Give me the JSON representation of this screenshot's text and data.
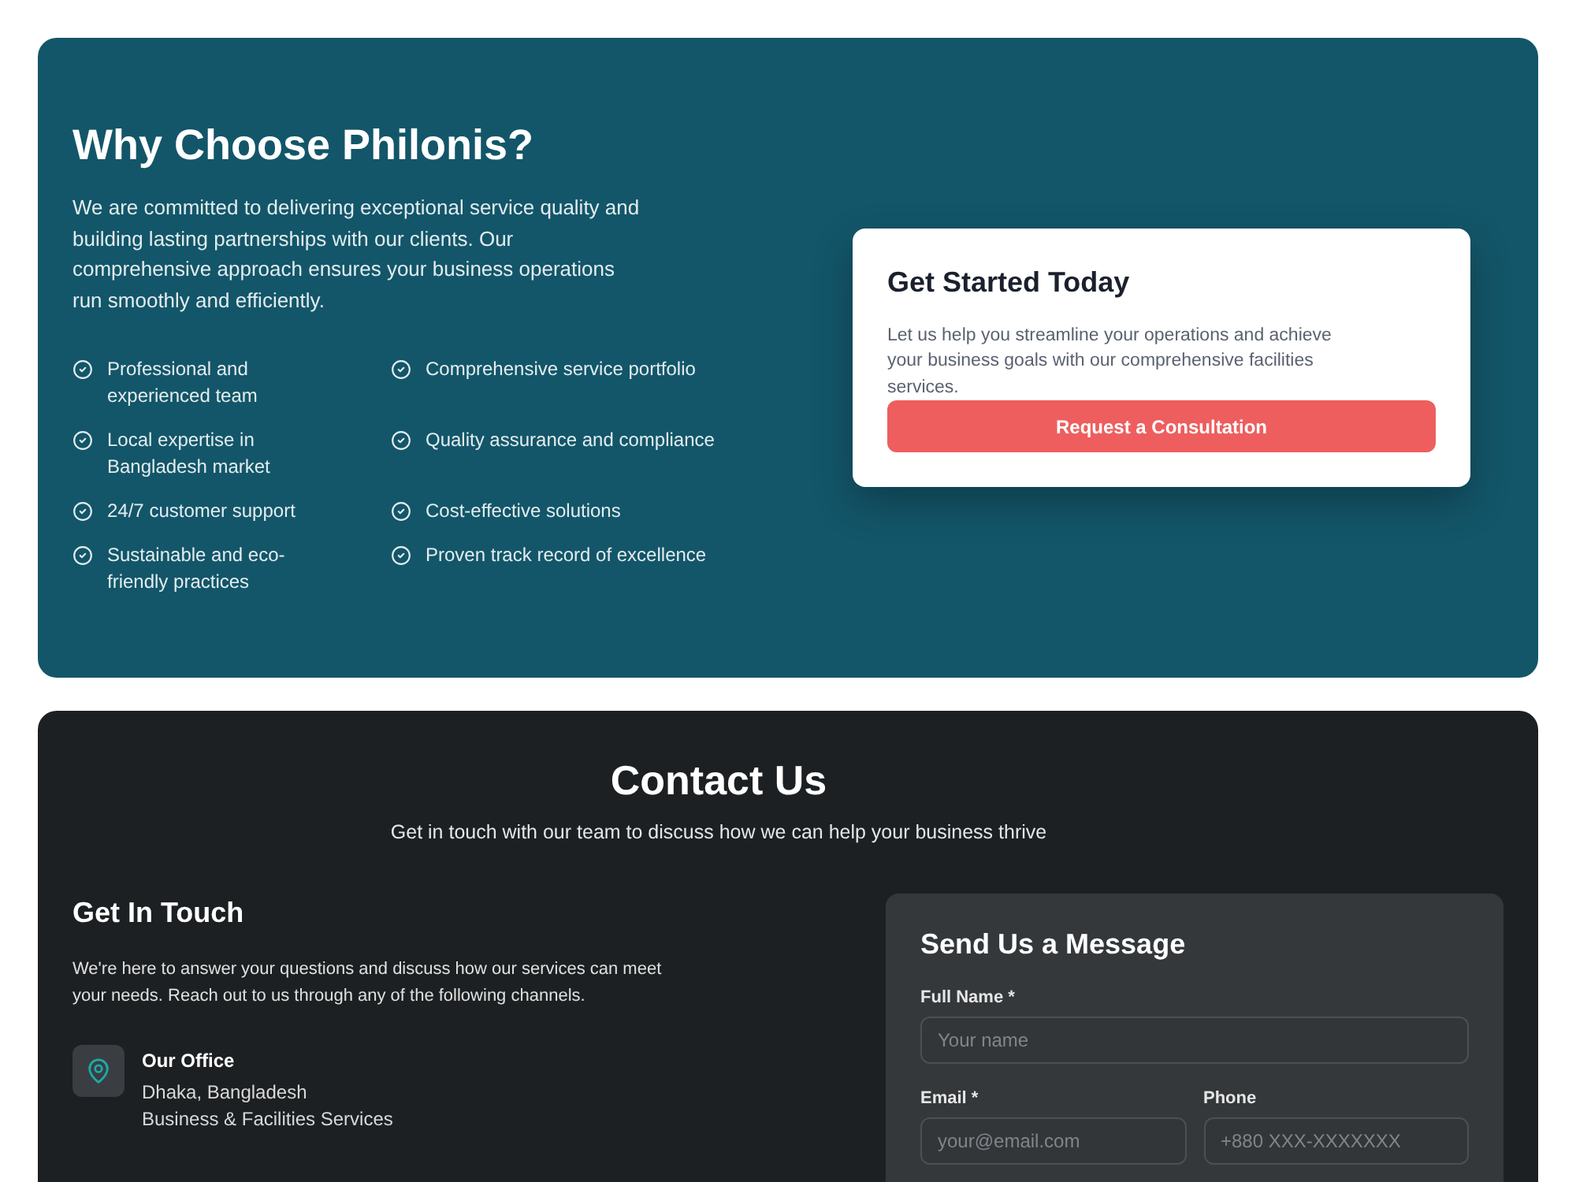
{
  "why_choose": {
    "title": "Why Choose Philonis?",
    "description": "We are committed to delivering exceptional service quality and building lasting partnerships with our clients. Our comprehensive approach ensures your business operations run smoothly and efficiently.",
    "features": [
      {
        "label": "Professional and experienced team"
      },
      {
        "label": "Comprehensive service portfolio"
      },
      {
        "label": "Local expertise in Bangladesh market"
      },
      {
        "label": "Quality assurance and compliance"
      },
      {
        "label": "24/7 customer support"
      },
      {
        "label": "Cost-effective solutions"
      },
      {
        "label": "Sustainable and eco-friendly practices"
      },
      {
        "label": "Proven track record of excellence"
      }
    ],
    "cta_card": {
      "title": "Get Started Today",
      "description": "Let us help you streamline your operations and achieve your business goals with our comprehensive facilities services.",
      "button": "Request a Consultation"
    }
  },
  "contact": {
    "title": "Contact Us",
    "subtitle": "Get in touch with our team to discuss how we can help your business thrive",
    "get_in_touch": {
      "title": "Get In Touch",
      "description": "We're here to answer your questions and discuss how our services can meet your needs. Reach out to us through any of the following channels.",
      "channels": [
        {
          "title": "Our Office",
          "lines": [
            "Dhaka, Bangladesh",
            "Business & Facilities Services"
          ]
        }
      ]
    },
    "form": {
      "title": "Send Us a Message",
      "rows": [
        {
          "fields": [
            {
              "label": "Full Name *",
              "placeholder": "Your name"
            }
          ]
        },
        {
          "fields": [
            {
              "label": "Email *",
              "placeholder": "your@email.com"
            },
            {
              "label": "Phone",
              "placeholder": "+880 XXX-XXXXXXX"
            }
          ]
        }
      ]
    }
  }
}
